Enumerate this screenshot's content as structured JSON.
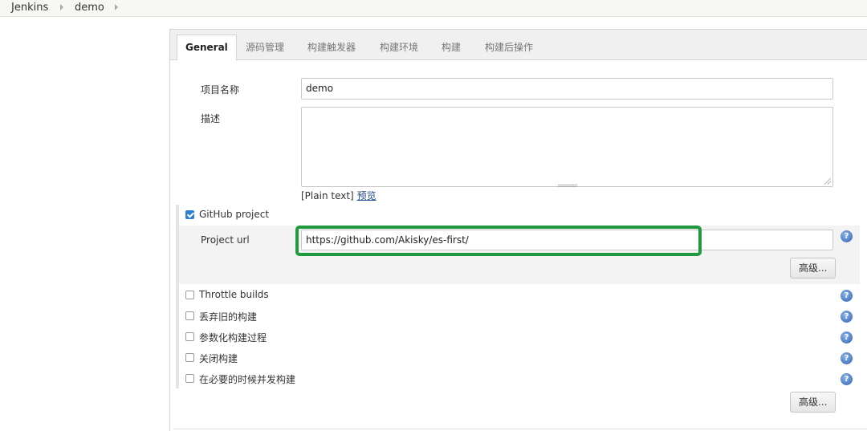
{
  "breadcrumb": {
    "items": [
      "Jenkins",
      "demo"
    ]
  },
  "tabs": [
    "General",
    "源码管理",
    "构建触发器",
    "构建环境",
    "构建",
    "构建后操作"
  ],
  "active_tab": "General",
  "fields": {
    "project_name_label": "项目名称",
    "project_name_value": "demo",
    "description_label": "描述",
    "description_value": "",
    "plain_text": "[Plain text]",
    "preview_link": "预览"
  },
  "github": {
    "checkbox_label": "GitHub project",
    "checked": true,
    "url_label": "Project url",
    "url_value": "https://github.com/Akisky/es-first/",
    "advanced_button": "高级..."
  },
  "options": [
    {
      "label": "Throttle builds",
      "checked": false
    },
    {
      "label": "丢弃旧的构建",
      "checked": false
    },
    {
      "label": "参数化构建过程",
      "checked": false
    },
    {
      "label": "关闭构建",
      "checked": false
    },
    {
      "label": "在必要的时候并发构建",
      "checked": false
    }
  ],
  "advanced_button_bottom": "高级...",
  "help_glyph": "?",
  "icons": {
    "help": "help-icon",
    "breadcrumb_separator": "chevron-right-icon"
  },
  "colors": {
    "highlight": "#1f9a3c",
    "checkbox_checked": "#2f7fd6",
    "help_icon": "#2c62b5"
  }
}
